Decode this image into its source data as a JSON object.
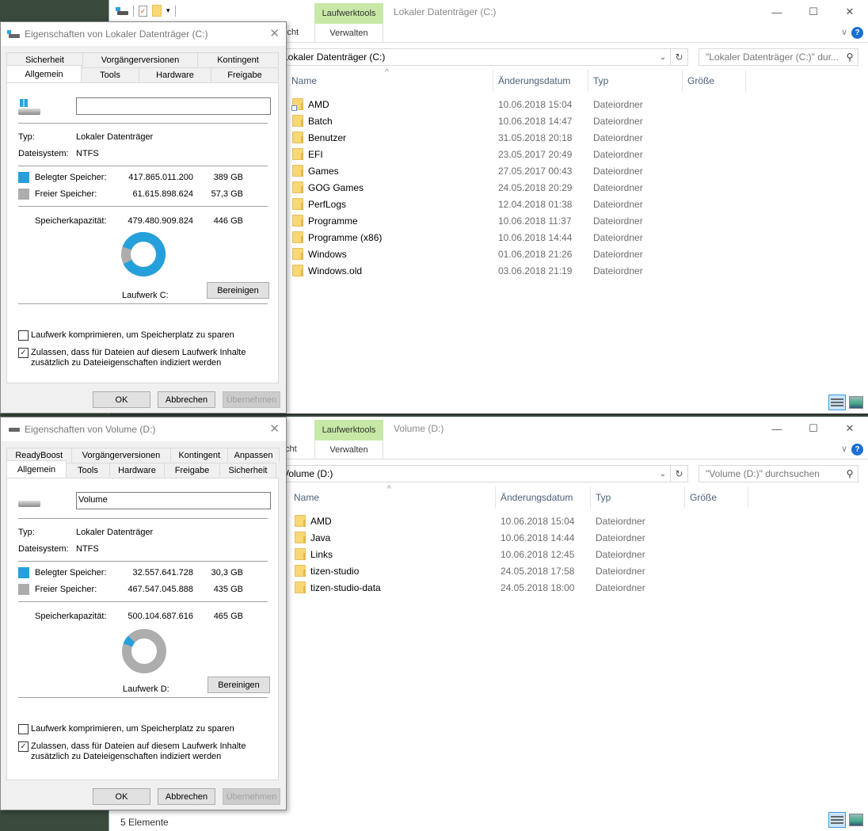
{
  "explorer_c": {
    "quick_access": [
      "drive-icon",
      "properties-icon",
      "new-folder-icon",
      "customize-icon"
    ],
    "context_tab": "Laufwerktools",
    "window_title": "Lokaler Datenträger (C:)",
    "ribbon": {
      "ansicht_partial": "icht",
      "verwalten": "Verwalten"
    },
    "address": "Lokaler Datenträger (C:)",
    "search_placeholder": "\"Lokaler Datenträger (C:)\" dur...",
    "columns": [
      "Name",
      "Änderungsdatum",
      "Typ",
      "Größe"
    ],
    "rows": [
      {
        "name": "AMD",
        "date": "10.06.2018 15:04",
        "type": "Dateiordner",
        "shortcut": true
      },
      {
        "name": "Batch",
        "date": "10.06.2018 14:47",
        "type": "Dateiordner"
      },
      {
        "name": "Benutzer",
        "date": "31.05.2018 20:18",
        "type": "Dateiordner"
      },
      {
        "name": "EFI",
        "date": "23.05.2017 20:49",
        "type": "Dateiordner"
      },
      {
        "name": "Games",
        "date": "27.05.2017 00:43",
        "type": "Dateiordner"
      },
      {
        "name": "GOG Games",
        "date": "24.05.2018 20:29",
        "type": "Dateiordner"
      },
      {
        "name": "PerfLogs",
        "date": "12.04.2018 01:38",
        "type": "Dateiordner"
      },
      {
        "name": "Programme",
        "date": "10.06.2018 11:37",
        "type": "Dateiordner"
      },
      {
        "name": "Programme (x86)",
        "date": "10.06.2018 14:44",
        "type": "Dateiordner"
      },
      {
        "name": "Windows",
        "date": "01.06.2018 21:26",
        "type": "Dateiordner"
      },
      {
        "name": "Windows.old",
        "date": "03.06.2018 21:19",
        "type": "Dateiordner"
      }
    ]
  },
  "explorer_d": {
    "context_tab": "Laufwerktools",
    "window_title": "Volume (D:)",
    "ribbon": {
      "ansicht_partial": "cht",
      "verwalten": "Verwalten"
    },
    "address": "Volume (D:)",
    "search_placeholder": "\"Volume (D:)\" durchsuchen",
    "columns": [
      "Name",
      "Änderungsdatum",
      "Typ",
      "Größe"
    ],
    "rows": [
      {
        "name": "AMD",
        "date": "10.06.2018 15:04",
        "type": "Dateiordner"
      },
      {
        "name": "Java",
        "date": "10.06.2018 14:44",
        "type": "Dateiordner"
      },
      {
        "name": "Links",
        "date": "10.06.2018 12:45",
        "type": "Dateiordner"
      },
      {
        "name": "tizen-studio",
        "date": "24.05.2018 17:58",
        "type": "Dateiordner"
      },
      {
        "name": "tizen-studio-data",
        "date": "24.05.2018 18:00",
        "type": "Dateiordner"
      }
    ],
    "status": "5 Elemente"
  },
  "window_controls": {
    "minimize": "—",
    "maximize": "☐",
    "close": "✕",
    "help": "?",
    "collapse": "∨"
  },
  "dialog_c": {
    "title": "Eigenschaften von Lokaler Datenträger (C:)",
    "tabs_back": [
      "Sicherheit",
      "Vorgängerversionen",
      "Kontingent"
    ],
    "tabs_front": [
      "Allgemein",
      "Tools",
      "Hardware",
      "Freigabe"
    ],
    "active_tab": "Allgemein",
    "name_value": "",
    "type_label": "Typ:",
    "type_value": "Lokaler Datenträger",
    "fs_label": "Dateisystem:",
    "fs_value": "NTFS",
    "used_label": "Belegter Speicher:",
    "used_bytes": "417.865.011.200",
    "used_size": "389 GB",
    "free_label": "Freier Speicher:",
    "free_bytes": "61.615.898.624",
    "free_size": "57,3 GB",
    "cap_label": "Speicherkapazität:",
    "cap_bytes": "479.480.909.824",
    "cap_size": "446 GB",
    "used_fraction": 0.8715,
    "drive_label": "Laufwerk C:",
    "cleanup": "Bereinigen",
    "compress_label": "Laufwerk komprimieren, um Speicherplatz zu sparen",
    "compress_checked": false,
    "index_label_1": "Zulassen, dass für Dateien auf diesem Laufwerk Inhalte",
    "index_label_2": "zusätzlich zu Dateieigenschaften indiziert werden",
    "index_checked": true,
    "ok": "OK",
    "cancel": "Abbrechen",
    "apply": "Übernehmen"
  },
  "dialog_d": {
    "title": "Eigenschaften von Volume (D:)",
    "tabs_back": [
      "ReadyBoost",
      "Vorgängerversionen",
      "Kontingent",
      "Anpassen"
    ],
    "tabs_front": [
      "Allgemein",
      "Tools",
      "Hardware",
      "Freigabe",
      "Sicherheit"
    ],
    "active_tab": "Allgemein",
    "name_value": "Volume",
    "type_label": "Typ:",
    "type_value": "Lokaler Datenträger",
    "fs_label": "Dateisystem:",
    "fs_value": "NTFS",
    "used_label": "Belegter Speicher:",
    "used_bytes": "32.557.641.728",
    "used_size": "30,3 GB",
    "free_label": "Freier Speicher:",
    "free_bytes": "467.547.045.888",
    "free_size": "435 GB",
    "cap_label": "Speicherkapazität:",
    "cap_bytes": "500.104.687.616",
    "cap_size": "465 GB",
    "used_fraction": 0.0651,
    "drive_label": "Laufwerk D:",
    "cleanup": "Bereinigen",
    "compress_label": "Laufwerk komprimieren, um Speicherplatz zu sparen",
    "compress_checked": false,
    "index_label_1": "Zulassen, dass für Dateien auf diesem Laufwerk Inhalte",
    "index_label_2": "zusätzlich zu Dateieigenschaften indiziert werden",
    "index_checked": true,
    "ok": "OK",
    "cancel": "Abbrechen",
    "apply": "Übernehmen"
  },
  "colors": {
    "used": "#26a0da",
    "free": "#adadad",
    "context_tab": "#c7e8a6",
    "folder": "#f8d775"
  }
}
